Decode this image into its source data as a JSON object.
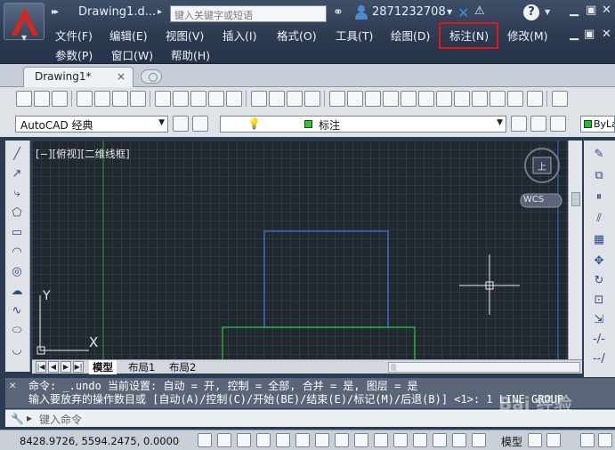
{
  "app": {
    "doc_title": "Drawing1.d...",
    "search_placeholder": "键入关键字或短语",
    "user_id": "2871232708"
  },
  "menus": [
    {
      "label": "文件(F)"
    },
    {
      "label": "编辑(E)"
    },
    {
      "label": "视图(V)"
    },
    {
      "label": "插入(I)"
    },
    {
      "label": "格式(O)"
    },
    {
      "label": "工具(T)"
    },
    {
      "label": "绘图(D)"
    },
    {
      "label": "标注(N)"
    },
    {
      "label": "修改(M)"
    },
    {
      "label": "参数(P)"
    },
    {
      "label": "窗口(W)"
    },
    {
      "label": "帮助(H)"
    }
  ],
  "highlighted_menu": "标注(N)",
  "tabs": {
    "document_tab": "Drawing1*",
    "close_glyph": "×"
  },
  "toolbar": {
    "workspace_select": "AutoCAD 经典",
    "layer_name": "标注",
    "color_select": "ByLa"
  },
  "canvas": {
    "viewport_label": "[−][俯视][二维线框]",
    "viewcube_face": "上",
    "wcs_label": "WCS",
    "ucs_x": "X",
    "ucs_y": "Y"
  },
  "layout_tabs": [
    {
      "label": "模型",
      "active": true
    },
    {
      "label": "布局1",
      "active": false
    },
    {
      "label": "布局2",
      "active": false
    }
  ],
  "command": {
    "history_line1": "命令: _.undo 当前设置: 自动 = 开, 控制 = 全部, 合并 = 是, 图层 = 是",
    "history_line2": "输入要放弃的操作数目或 [自动(A)/控制(C)/开始(BE)/结束(E)/标记(M)/后退(B)] <1>: 1 LINE GROUP",
    "input_placeholder": "键入命令"
  },
  "status": {
    "coordinates": "8428.9726, 5594.2475, 0.0000",
    "model_label": "模型"
  },
  "colors": {
    "canvas_bg": "#212830",
    "blue_entity": "#3a7be0",
    "green_entity": "#1fd12a",
    "highlight_red": "#e3141a"
  }
}
